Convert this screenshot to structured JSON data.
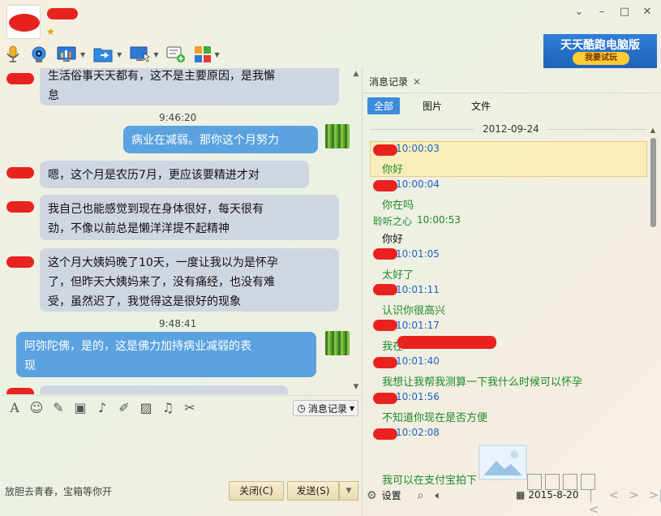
{
  "header": {
    "window_controls": [
      "chevron-down-icon",
      "minimize-icon",
      "maximize-icon",
      "close-icon"
    ]
  },
  "ad": {
    "title": "天天酷跑电脑版",
    "button": "我要试玩"
  },
  "chat": {
    "messages": [
      {
        "side": "in",
        "text_1": "生活俗事天天都有，这不是主要原因，是我懈",
        "text_2": "怠"
      },
      {
        "time": "9:46:20"
      },
      {
        "side": "out",
        "text_1": "病业在减弱。那你这个月努力"
      },
      {
        "side": "in",
        "text_1": "嗯，这个月是农历7月，更应该要精进才对"
      },
      {
        "side": "in",
        "text_1": "我自己也能感觉到现在身体很好，每天很有",
        "text_2": "劲，不像以前总是懒洋洋提不起精神"
      },
      {
        "side": "in",
        "text_1": "这个月大姨妈晚了10天，一度让我以为是怀孕",
        "text_2": "了，但昨天大姨妈来了，没有痛经，也没有难",
        "text_3": "受，虽然迟了，我觉得这是很好的现象"
      },
      {
        "time": "9:48:41"
      },
      {
        "side": "out",
        "text_1": "阿弥陀佛，是的，这是佛力加持病业减弱的表",
        "text_2": "现"
      }
    ]
  },
  "input_toolbar": {
    "history_label": "消息记录"
  },
  "footer": {
    "tip": "放胆去青春，宝箱等你开",
    "close_label": "关闭(C)",
    "send_label": "发送(S)"
  },
  "history_panel": {
    "tab_label": "消息记录",
    "filters": [
      "全部",
      "图片",
      "文件"
    ],
    "date": "2012-09-24",
    "entries": [
      {
        "time": "10:00:03",
        "text": "你好",
        "who": "self"
      },
      {
        "time": "10:00:04",
        "text": "你在吗",
        "who": "self"
      },
      {
        "sender": "聆听之心",
        "time": "10:00:53",
        "text": "你好",
        "who": "peer"
      },
      {
        "time": "10:01:05",
        "text": "太好了",
        "who": "self"
      },
      {
        "time": "10:01:11",
        "text": "认识你很高兴",
        "who": "self"
      },
      {
        "time": "10:01:17",
        "text": "我在",
        "who": "self"
      },
      {
        "time": "10:01:40",
        "text": "我想让我帮我测算一下我什么时候可以怀孕",
        "who": "self"
      },
      {
        "time": "10:01:56",
        "text": "不知道你现在是否方便",
        "who": "self"
      },
      {
        "time": "10:02:08",
        "text": "我可以在支付宝拍下",
        "who": "self"
      }
    ],
    "settings_label": "设置",
    "footer_date": "2015-8-20"
  }
}
